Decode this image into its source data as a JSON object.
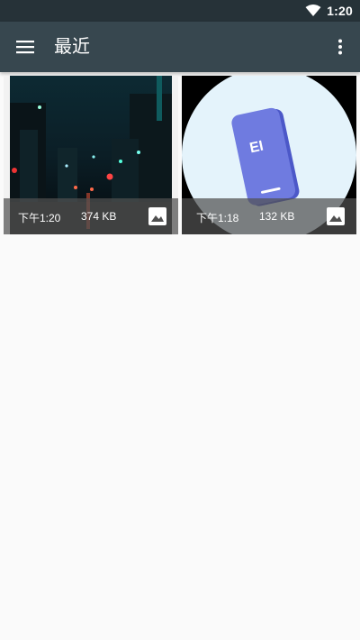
{
  "status_bar": {
    "time": "1:20",
    "wifi_icon": "wifi-icon"
  },
  "app_bar": {
    "title": "最近",
    "menu_icon": "menu-icon",
    "overflow_icon": "more-vert-icon"
  },
  "items": [
    {
      "date": "下午1:20",
      "size": "374 KB",
      "type_icon": "image-icon"
    },
    {
      "date": "下午1:18",
      "size": "132 KB",
      "type_icon": "image-icon"
    }
  ],
  "colors": {
    "status_bar": "#263238",
    "app_bar": "#37474f",
    "background": "#fafafa"
  }
}
